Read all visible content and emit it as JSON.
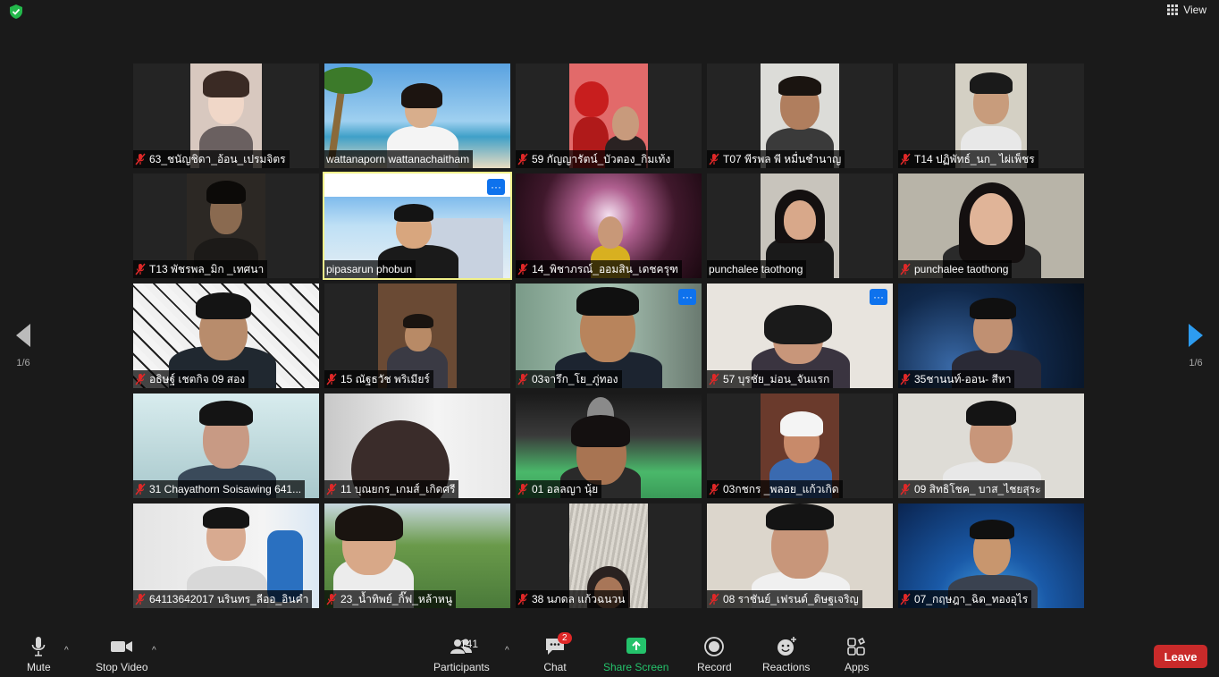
{
  "top": {
    "view_label": "View"
  },
  "nav": {
    "page_left": "1/6",
    "page_right": "1/6"
  },
  "participants": [
    {
      "name": "63_ชนัญชิดา_อ้อน_เปรมจิตร",
      "muted": true
    },
    {
      "name": "wattanaporn wattanachaitham",
      "muted": false
    },
    {
      "name": "59 กัญญารัตน์_บัวตอง_กิมเท้ง",
      "muted": true
    },
    {
      "name": "T07 พีรพล พี หมื่นชำนาญ",
      "muted": true
    },
    {
      "name": "T14 ปฏิพัทธ์_นก_ ไผ่เพ็ชร",
      "muted": true
    },
    {
      "name": "T13 พัชรพล_มิก _เทศนา",
      "muted": true
    },
    {
      "name": "pipasarun phobun",
      "muted": false,
      "speaking": true
    },
    {
      "name": "14_พิชาภรณ์_ออมสิน_เดชครุฑ",
      "muted": true
    },
    {
      "name": "punchalee taothong",
      "muted": false
    },
    {
      "name": "punchalee taothong",
      "muted": true
    },
    {
      "name": "อธิษฐ์ เชตกิจ 09 สอง",
      "muted": true
    },
    {
      "name": "15 ณัฐธวัช พริเมียร์",
      "muted": true
    },
    {
      "name": "03จารึก_โย_ภู่ทอง",
      "muted": true
    },
    {
      "name": "57 บุรชัย_ม่อน_จันแรก",
      "muted": true
    },
    {
      "name": "35ชานนท์-ออน- สีหา",
      "muted": true
    },
    {
      "name": "31 Chayathorn Soisawing 641...",
      "muted": true
    },
    {
      "name": "11 บุณยกร_เกมส์_เกิดศรี",
      "muted": true
    },
    {
      "name": "01 อลลญา นุ้ย",
      "muted": true
    },
    {
      "name": "03กชกร _พลอย_แก้วเกิด",
      "muted": true
    },
    {
      "name": "09 สิทธิโชค_ บาส_ไชยสุระ",
      "muted": true
    },
    {
      "name": "64113642017 นรินทร_ลีออ_อินคำ",
      "muted": true
    },
    {
      "name": "23_น้ำทิพย์_กิ๊ฟ_หล้าหนู",
      "muted": true
    },
    {
      "name": "38 นภดล แก้วฉนวน",
      "muted": true
    },
    {
      "name": "08 ราชันย์_เฟรนด์_ดิษฐเจริญ",
      "muted": true
    },
    {
      "name": "07_กฤษฎา_ฉิด_ทองอุไร",
      "muted": true
    }
  ],
  "toolbar": {
    "mute_label": "Mute",
    "stop_video_label": "Stop Video",
    "participants_label": "Participants",
    "participants_count": "141",
    "chat_label": "Chat",
    "chat_badge": "2",
    "share_label": "Share Screen",
    "record_label": "Record",
    "reactions_label": "Reactions",
    "apps_label": "Apps",
    "leave_label": "Leave"
  },
  "colors": {
    "background": "#1a1a1a",
    "share_green": "#24c26b",
    "leave_red": "#c92a2a",
    "speaker_highlight": "#f0f08a",
    "menu_blue": "#0e72ed",
    "muted_red": "#e02828"
  }
}
